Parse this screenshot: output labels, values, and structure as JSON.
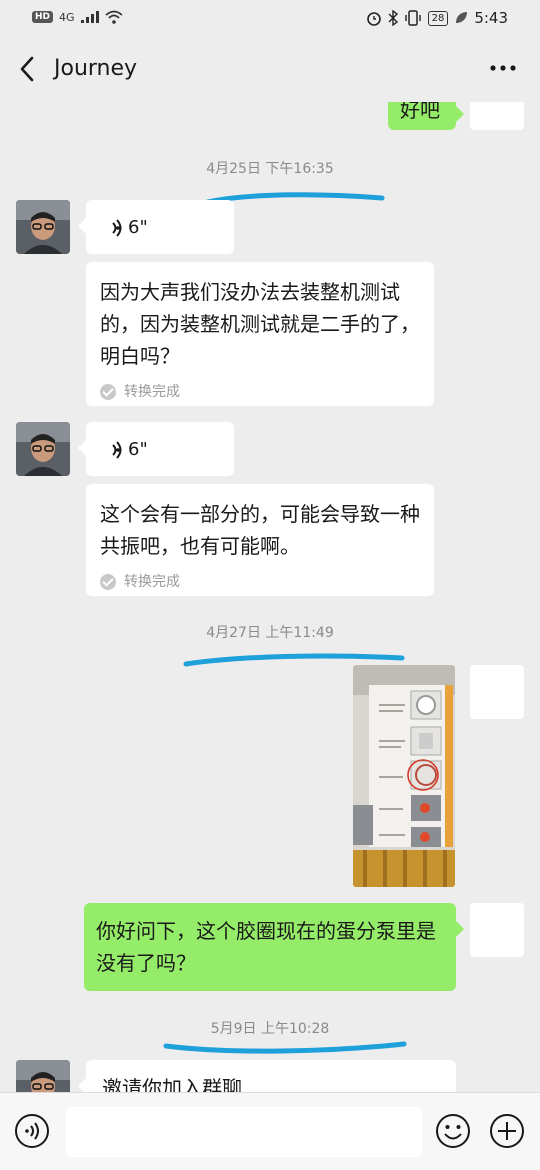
{
  "status_bar": {
    "hd": "HD",
    "network": "4G",
    "battery": "28",
    "time": "5:43"
  },
  "header": {
    "title": "Journey"
  },
  "messages": {
    "top_partial": "好吧",
    "ts1": "4月25日 下午16:35",
    "voice1_duration": "6\"",
    "text1": "因为大声我们没办法去装整机测试的，因为装整机测试就是二手的了，明白吗？",
    "convert1": "转换完成",
    "voice2_duration": "6\"",
    "text2": "这个会有一部分的，可能会导致一种共振吧，也有可能啊。",
    "convert2": "转换完成",
    "ts2": "4月27日 上午11:49",
    "my_text": "你好问下，这个胶圈现在的蛋分泵里是没有了吗？",
    "ts3": "5月9日 上午10:28",
    "invite_partial": "邀请你加入群聊"
  },
  "icons": {
    "voice": "voice-toggle-icon",
    "emoji": "emoji-icon",
    "plus": "plus-icon",
    "back": "back-arrow-icon",
    "more": "more-dots-icon"
  },
  "colors": {
    "background": "#ededed",
    "my_bubble": "#95ec69",
    "their_bubble": "#ffffff",
    "scribble": "#1ea0db"
  }
}
